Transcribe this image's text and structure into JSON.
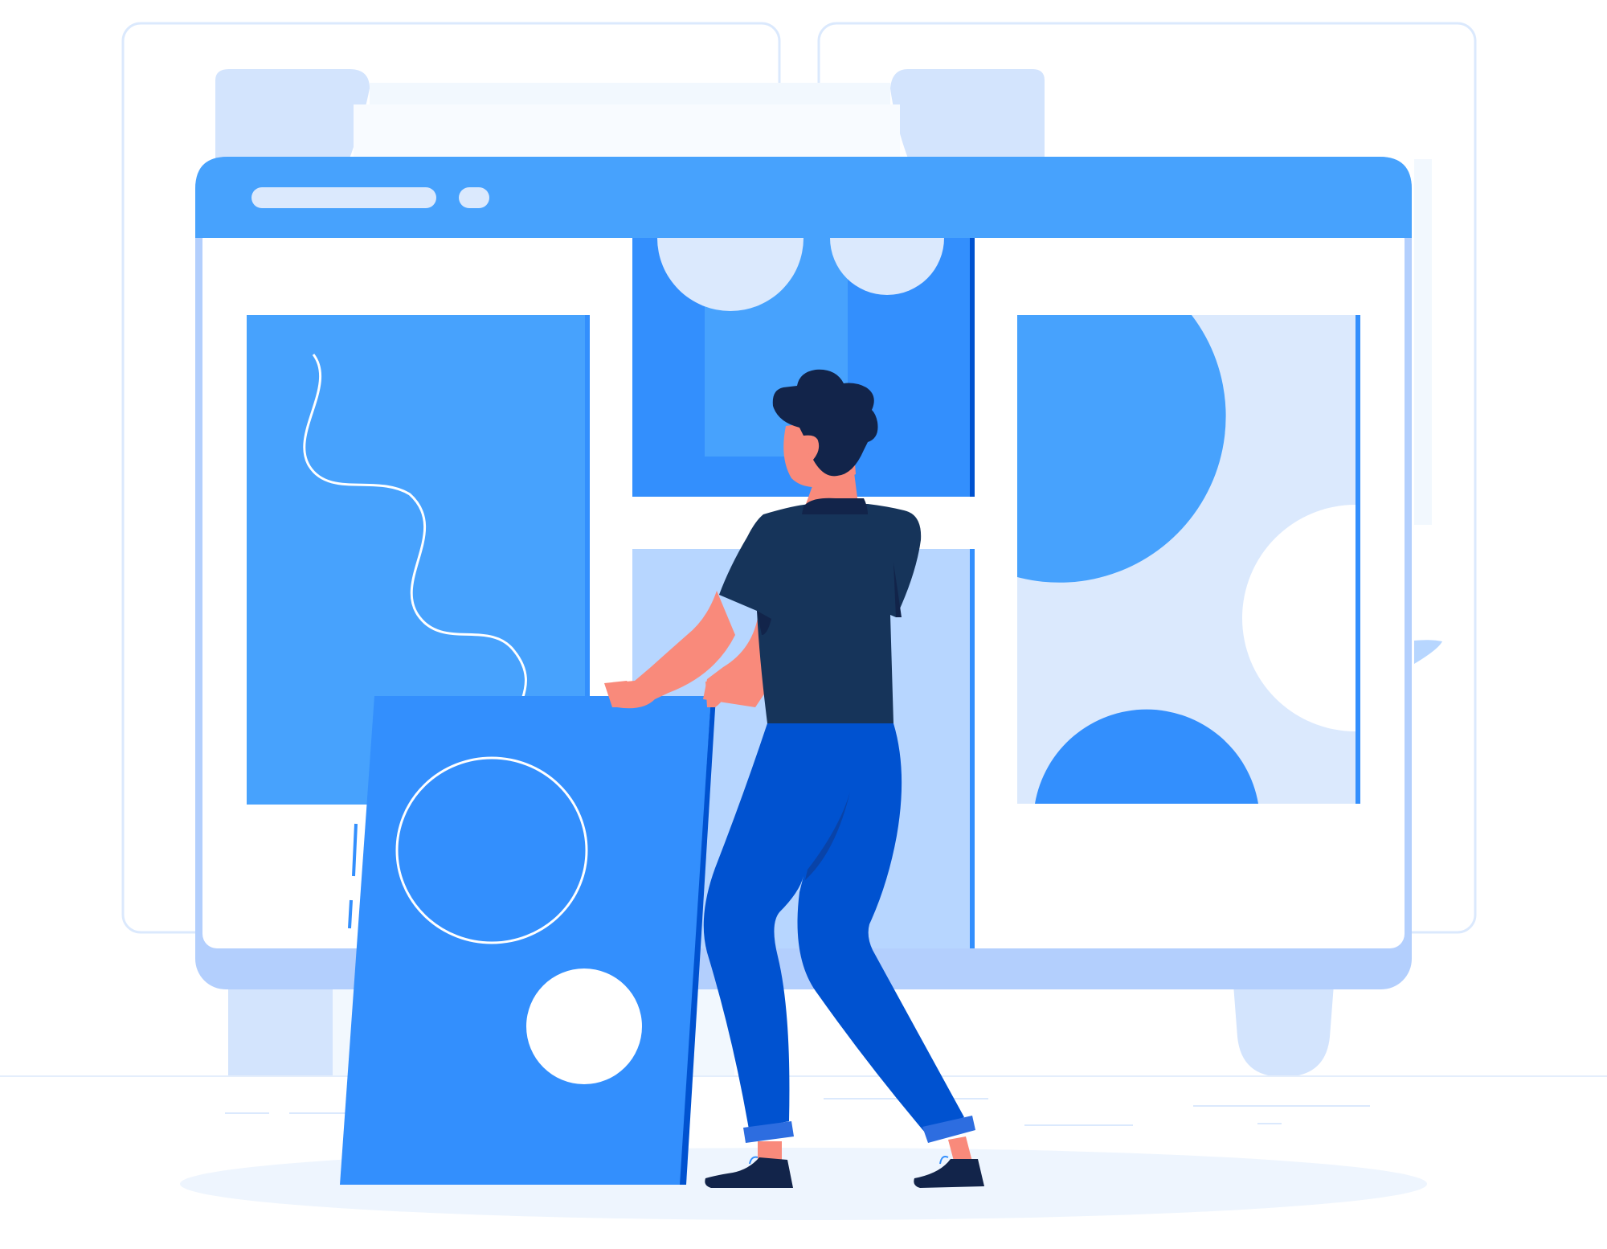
{
  "illustration": {
    "subject": "person-arranging-web-layout-panels",
    "colors": {
      "background": "#ffffff",
      "primary_blue": "#338ffd",
      "mid_blue": "#47a2fd",
      "dark_blue": "#0052d0",
      "light_blue": "#b7d6ff",
      "pale_blue": "#dbe9fd",
      "faint_blue": "#eef5fe",
      "navy": "#16345a",
      "hair": "#12244a",
      "skin": "#f98a7b"
    },
    "icons": [
      "browser-window",
      "address-bar",
      "image-placeholder",
      "person",
      "wavy-line"
    ]
  }
}
